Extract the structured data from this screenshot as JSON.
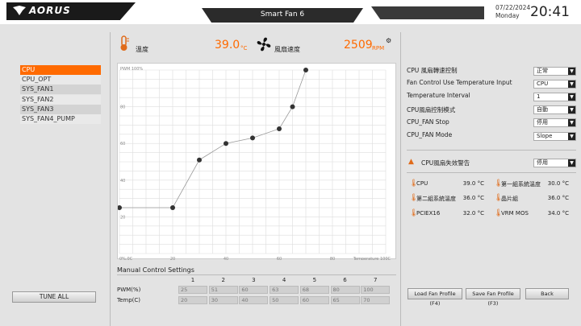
{
  "app": {
    "brand": "AORUS",
    "title": "Smart Fan 6",
    "date": "07/22/2024",
    "day": "Monday",
    "time": "20:41"
  },
  "header": {
    "temp_label": "溫度",
    "temp_value": "39.0",
    "temp_unit": "°C",
    "fan_label": "風扇速度",
    "fan_value": "2509",
    "fan_unit": "RPM",
    "accent": "#ff6a00"
  },
  "fans": [
    "CPU",
    "CPU_OPT",
    "SYS_FAN1",
    "SYS_FAN2",
    "SYS_FAN3",
    "SYS_FAN4_PUMP"
  ],
  "selected_fan": "CPU",
  "tune_all": "TUNE ALL",
  "chart_data": {
    "type": "line",
    "x": [
      0,
      20,
      30,
      40,
      50,
      60,
      65,
      70
    ],
    "y": [
      25,
      25,
      51,
      60,
      63,
      68,
      80,
      100
    ],
    "ylabel": "PWM 100%",
    "xlabel": "Temperature 100C",
    "x_tick_labels": [
      "0%,0C",
      "20",
      "40",
      "60",
      "80"
    ],
    "y_tick_labels": [
      "80",
      "60",
      "40",
      "20"
    ],
    "xlim": [
      0,
      100
    ],
    "ylim": [
      0,
      100
    ],
    "grid": true
  },
  "manual": {
    "title": "Manual Control Settings",
    "columns": [
      "1",
      "2",
      "3",
      "4",
      "5",
      "6",
      "7"
    ],
    "pwm_label": "PWM(%)",
    "temp_label": "Temp(C)",
    "pwm": [
      "25",
      "51",
      "60",
      "63",
      "68",
      "80",
      "100"
    ],
    "temp": [
      "20",
      "30",
      "40",
      "50",
      "60",
      "65",
      "70"
    ]
  },
  "settings": [
    {
      "label": "CPU 風扇轉速控制",
      "value": "正常"
    },
    {
      "label": "Fan Control Use Temperature Input",
      "value": "CPU"
    },
    {
      "label": "Temperature Interval",
      "value": "1"
    },
    {
      "label": "CPU風扇控制模式",
      "value": "自動"
    },
    {
      "label": "CPU_FAN Stop",
      "value": "停用"
    },
    {
      "label": "CPU_FAN Mode",
      "value": "Slope"
    }
  ],
  "warning": {
    "label": "CPU風扇失效警告",
    "value": "停用"
  },
  "sensors": [
    {
      "name": "CPU",
      "value": "39.0 °C"
    },
    {
      "name": "第一組系統溫度",
      "value": "30.0 °C"
    },
    {
      "name": "第二組系統溫度",
      "value": "36.0 °C"
    },
    {
      "name": "晶片組",
      "value": "36.0 °C"
    },
    {
      "name": "PCIEX16",
      "value": "32.0 °C"
    },
    {
      "name": "VRM MOS",
      "value": "34.0 °C"
    }
  ],
  "buttons": {
    "load": "Load Fan Profile (F4)",
    "save": "Save Fan Profile (F3)",
    "back": "Back"
  }
}
